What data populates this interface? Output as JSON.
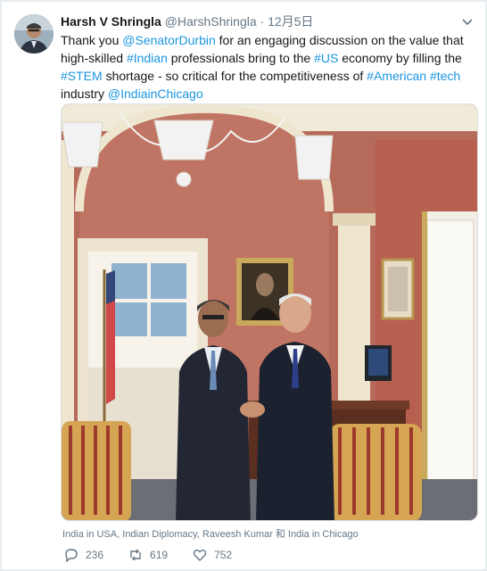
{
  "tweet": {
    "author_name": "Harsh V Shringla",
    "author_handle": "@HarshShringla",
    "separator": "·",
    "date": "12月5日",
    "text_parts": [
      {
        "t": "Thank you ",
        "link": false
      },
      {
        "t": "@SenatorDurbin",
        "link": true
      },
      {
        "t": " for an engaging discussion on the value that high-skilled ",
        "link": false
      },
      {
        "t": "#Indian",
        "link": true
      },
      {
        "t": " professionals bring to the ",
        "link": false
      },
      {
        "t": "#US",
        "link": true
      },
      {
        "t": " economy by filling the ",
        "link": false
      },
      {
        "t": "#STEM",
        "link": true
      },
      {
        "t": " shortage - so critical for the competitiveness of ",
        "link": false
      },
      {
        "t": "#American",
        "link": true
      },
      {
        "t": " ",
        "link": false
      },
      {
        "t": "#tech",
        "link": true
      },
      {
        "t": " industry ",
        "link": false
      },
      {
        "t": "@IndiainChicago",
        "link": true
      }
    ],
    "tagged": "India in USA, Indian Diplomacy, Raveesh Kumar 和 India in Chicago",
    "replies": "236",
    "retweets": "619",
    "likes": "752"
  },
  "colors": {
    "link": "#1b95e0",
    "secondary_text": "#657786",
    "wall": "#b66a5a",
    "trim": "#efe6cf"
  },
  "icons": {
    "avatar": "profile-photo",
    "caret": "chevron-down-icon",
    "reply": "reply-icon",
    "retweet": "retweet-icon",
    "like": "heart-icon"
  }
}
